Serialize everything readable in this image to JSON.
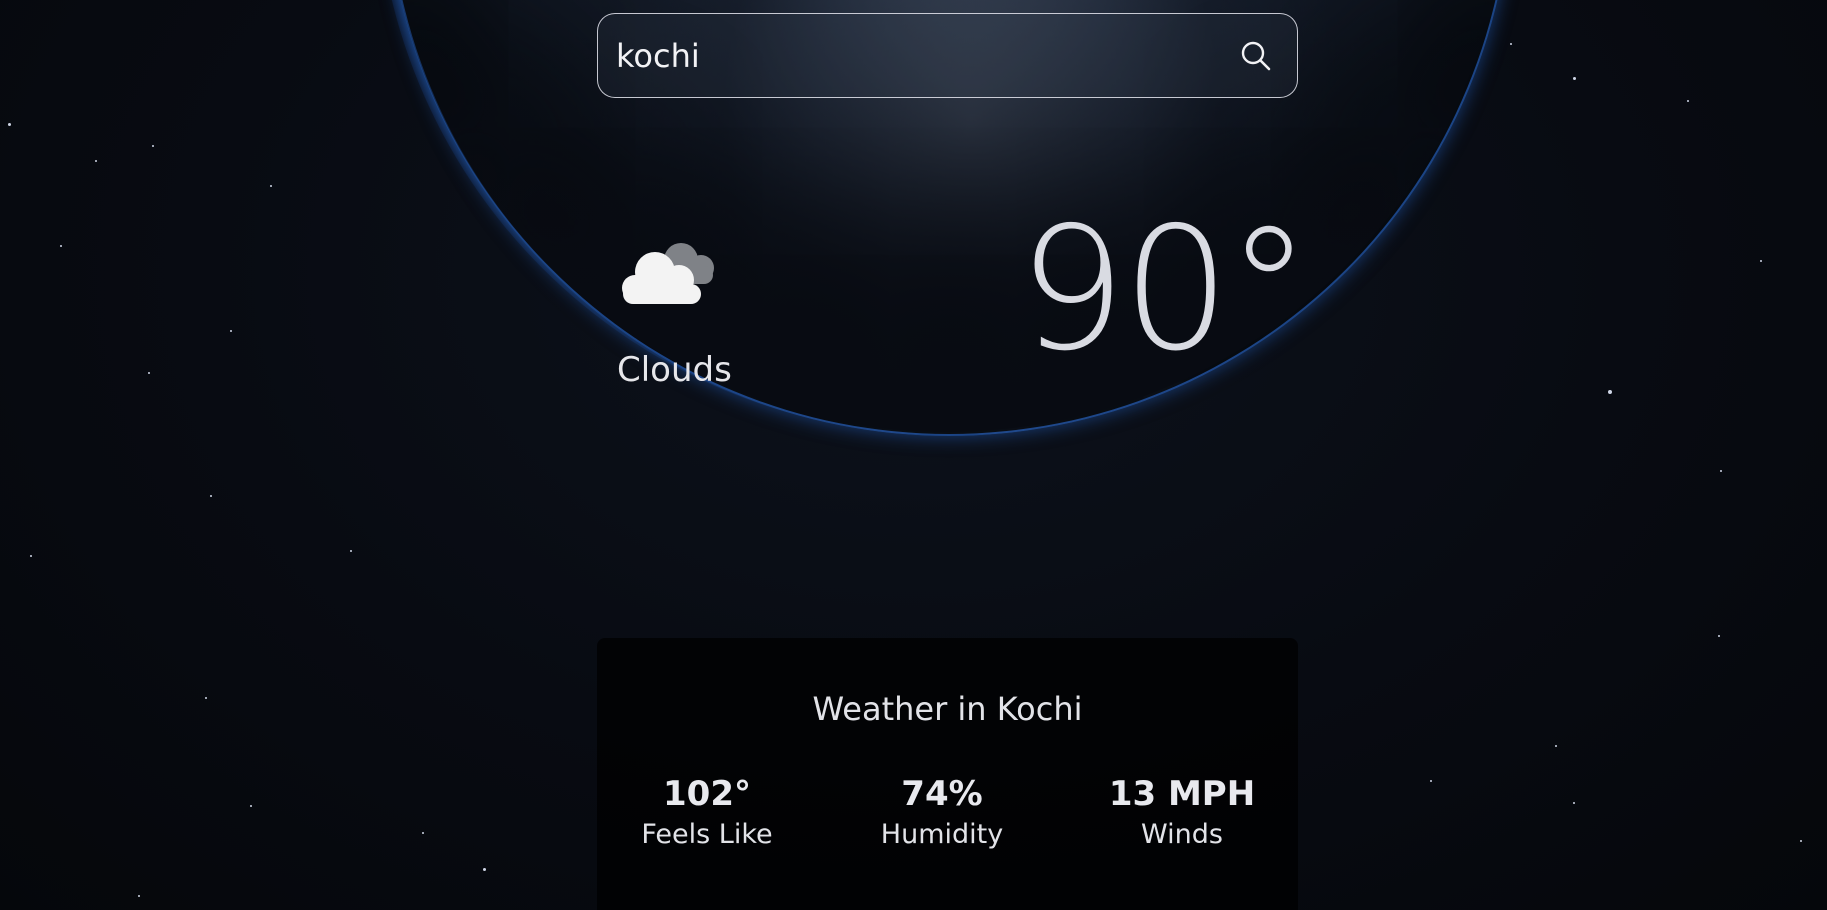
{
  "search": {
    "value": "kochi",
    "icon": "search-icon"
  },
  "current": {
    "icon": "clouds-icon",
    "condition": "Clouds",
    "temperature": "90°"
  },
  "details": {
    "title": "Weather in Kochi",
    "stats": [
      {
        "value": "102°",
        "label": "Feels Like"
      },
      {
        "value": "74%",
        "label": "Humidity"
      },
      {
        "value": "13 MPH",
        "label": "Winds"
      }
    ]
  },
  "colors": {
    "background": "#070a10",
    "atmosphere": "#2e78e6",
    "text": "#e6e6ea",
    "card": "#000000"
  }
}
